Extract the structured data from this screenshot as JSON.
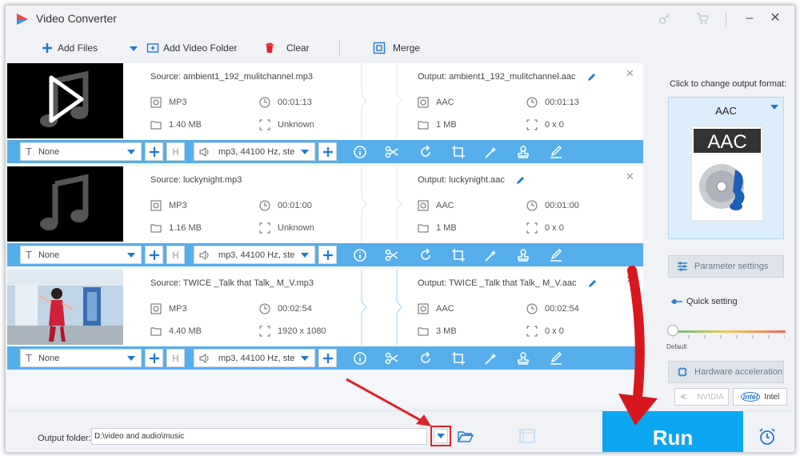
{
  "window": {
    "title": "Video Converter"
  },
  "toolbar": {
    "add_files": "Add Files",
    "add_video_folder": "Add Video Folder",
    "clear": "Clear",
    "merge": "Merge"
  },
  "items": [
    {
      "source": "Source: ambient1_192_mulitchannel.mp3",
      "output": "Output: ambient1_192_mulitchannel.aac",
      "src_format": "MP3",
      "src_duration": "00:01:13",
      "src_size": "1.40 MB",
      "src_resolution": "Unknown",
      "out_format": "AAC",
      "out_duration": "00:01:13",
      "out_size": "1 MB",
      "out_resolution": "0 x 0",
      "subtitle": "None",
      "audio": "mp3, 44100 Hz, ste",
      "thumb": "music-icon-with-play"
    },
    {
      "source": "Source: luckynight.mp3",
      "output": "Output: luckynight.aac",
      "src_format": "MP3",
      "src_duration": "00:01:00",
      "src_size": "1.16 MB",
      "src_resolution": "Unknown",
      "out_format": "AAC",
      "out_duration": "00:01:00",
      "out_size": "1 MB",
      "out_resolution": "0 x 0",
      "subtitle": "None",
      "audio": "mp3, 44100 Hz, ste",
      "thumb": "music-icon"
    },
    {
      "source": "Source: TWICE _Talk that Talk_ M_V.mp3",
      "output": "Output: TWICE _Talk that Talk_ M_V.aac",
      "src_format": "MP3",
      "src_duration": "00:02:54",
      "src_size": "4.40 MB",
      "src_resolution": "1920 x 1080",
      "out_format": "AAC",
      "out_duration": "00:02:54",
      "out_size": "3 MB",
      "out_resolution": "0 x 0",
      "subtitle": "None",
      "audio": "mp3, 44100 Hz, ste",
      "thumb": "video-frame"
    }
  ],
  "right_panel": {
    "title": "Click to change output format:",
    "format": "AAC",
    "format_icon_text": "AAC",
    "parameter_settings": "Parameter settings",
    "quick_setting": "Quick setting",
    "slider_label": "Default",
    "hardware_acceleration": "Hardware acceleration",
    "nvidia": "NVIDIA",
    "intel": "Intel"
  },
  "bottom": {
    "output_folder_label": "Output folder:",
    "output_folder_value": "D:\\video and audio\\music",
    "run": "Run"
  },
  "colors": {
    "accent": "#56adeb",
    "run": "#0da7f1",
    "highlight": "#e0242c"
  }
}
